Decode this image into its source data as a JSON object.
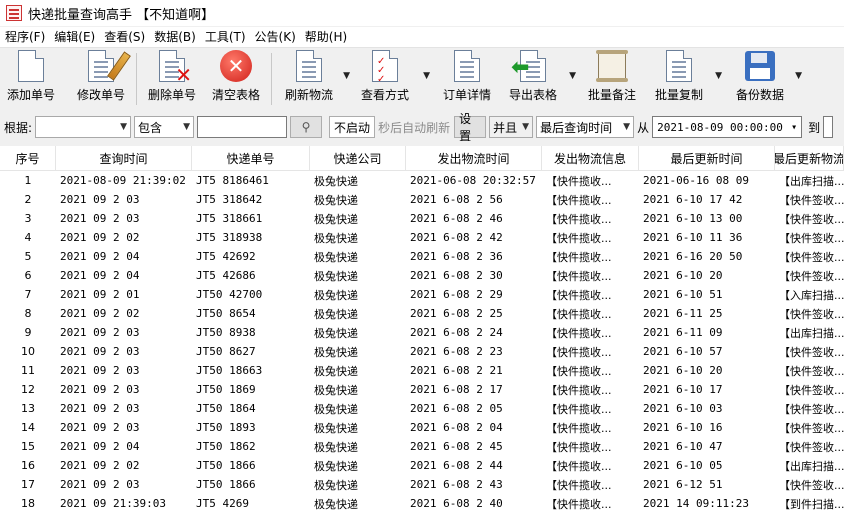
{
  "window": {
    "title": "快递批量查询高手 【不知道啊】"
  },
  "menu": [
    "程序(F)",
    "编辑(E)",
    "查看(S)",
    "数据(B)",
    "工具(T)",
    "公告(K)",
    "帮助(H)"
  ],
  "toolbar": {
    "add": "添加单号",
    "edit": "修改单号",
    "delete": "删除单号",
    "clear": "清空表格",
    "refresh": "刷新物流",
    "view": "查看方式",
    "details": "订单详情",
    "export": "导出表格",
    "batch_note": "批量备注",
    "batch_copy": "批量复制",
    "backup": "备份数据"
  },
  "filter": {
    "label": "根据:",
    "field_value": "",
    "match_value": "包含",
    "search_value": "",
    "autostart_button": "不启动",
    "auto_refresh_text": "秒后自动刷新",
    "settings_button": "设置",
    "logic_value": "并且",
    "time_field_value": "最后查询时间",
    "from_label": "从",
    "from_date": "2021-08-09 00:00:00",
    "to_label": "到"
  },
  "table": {
    "columns": [
      "序号",
      "查询时间",
      "快递单号",
      "快递公司",
      "发出物流时间",
      "发出物流信息",
      "最后更新时间",
      "最后更新物流"
    ],
    "rows": [
      [
        "1",
        "2021-08-09 21:39:02",
        "JT5 8186461",
        "极兔快递",
        "2021-06-08 20:32:57",
        "【快件揽收...",
        "2021-06-16 08 09",
        "【出库扫描..."
      ],
      [
        "2",
        "2021 09 2 03",
        "JT5 318642",
        "极兔快递",
        "2021 6-08 2 56",
        "【快件揽收...",
        "2021 6-10 17 42",
        "【快件签收..."
      ],
      [
        "3",
        "2021 09 2 03",
        "JT5 318661",
        "极兔快递",
        "2021 6-08 2 46",
        "【快件揽收...",
        "2021 6-10 13 00",
        "【快件签收..."
      ],
      [
        "4",
        "2021 09 2 02",
        "JT5 318938",
        "极兔快递",
        "2021 6-08 2 42",
        "【快件揽收...",
        "2021 6-10 11 36",
        "【快件签收..."
      ],
      [
        "5",
        "2021 09 2 04",
        "JT5 42692",
        "极兔快递",
        "2021 6-08 2 36",
        "【快件揽收...",
        "2021 6-16 20 50",
        "【快件签收..."
      ],
      [
        "6",
        "2021 09 2 04",
        "JT5 42686",
        "极兔快递",
        "2021 6-08 2 30",
        "【快件揽收...",
        "2021 6-10 20",
        "【快件签收..."
      ],
      [
        "7",
        "2021 09 2 01",
        "JT50 42700",
        "极兔快递",
        "2021 6-08 2 29",
        "【快件揽收...",
        "2021 6-10 51",
        "【入库扫描..."
      ],
      [
        "8",
        "2021 09 2 02",
        "JT50 8654",
        "极兔快递",
        "2021 6-08 2 25",
        "【快件揽收...",
        "2021 6-11 25",
        "【快件签收..."
      ],
      [
        "9",
        "2021 09 2 03",
        "JT50 8938",
        "极兔快递",
        "2021 6-08 2 24",
        "【快件揽收...",
        "2021 6-11 09",
        "【出库扫描..."
      ],
      [
        "10",
        "2021 09 2 03",
        "JT50 8627",
        "极兔快递",
        "2021 6-08 2 23",
        "【快件揽收...",
        "2021 6-10 57",
        "【快件签收..."
      ],
      [
        "11",
        "2021 09 2 03",
        "JT50 18663",
        "极兔快递",
        "2021 6-08 2 21",
        "【快件揽收...",
        "2021 6-10 20",
        "【快件签收..."
      ],
      [
        "12",
        "2021 09 2 03",
        "JT50 1869",
        "极兔快递",
        "2021 6-08 2 17",
        "【快件揽收...",
        "2021 6-10 17",
        "【快件签收..."
      ],
      [
        "13",
        "2021 09 2 03",
        "JT50 1864",
        "极兔快递",
        "2021 6-08 2 05",
        "【快件揽收...",
        "2021 6-10 03",
        "【快件签收..."
      ],
      [
        "14",
        "2021 09 2 03",
        "JT50 1893",
        "极兔快递",
        "2021 6-08 2 04",
        "【快件揽收...",
        "2021 6-10 16",
        "【快件签收..."
      ],
      [
        "15",
        "2021 09 2 04",
        "JT50 1862",
        "极兔快递",
        "2021 6-08 2 45",
        "【快件揽收...",
        "2021 6-10 47",
        "【快件签收..."
      ],
      [
        "16",
        "2021 09 2 02",
        "JT50 1866",
        "极兔快递",
        "2021 6-08 2 44",
        "【快件揽收...",
        "2021 6-10 05",
        "【出库扫描..."
      ],
      [
        "17",
        "2021 09 2 03",
        "JT50 1866",
        "极兔快递",
        "2021 6-08 2 43",
        "【快件揽收...",
        "2021 6-12 51",
        "【快件签收..."
      ],
      [
        "18",
        "2021 09 21:39:03",
        "JT5 4269",
        "极兔快递",
        "2021 6-08 2 40",
        "【快件揽收...",
        "2021 14 09:11:23",
        "【到件扫描..."
      ]
    ]
  }
}
